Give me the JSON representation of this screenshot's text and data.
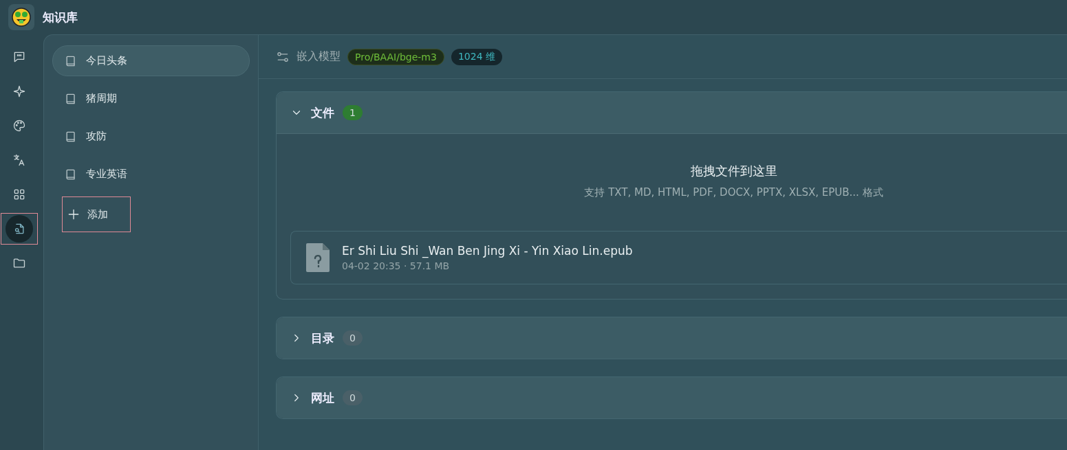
{
  "app": {
    "title": "知识库"
  },
  "rail": [
    {
      "selected": false,
      "highlighted": false
    },
    {
      "selected": false,
      "highlighted": false
    },
    {
      "selected": false,
      "highlighted": false
    },
    {
      "selected": false,
      "highlighted": false
    },
    {
      "selected": false,
      "highlighted": false
    },
    {
      "selected": true,
      "highlighted": true
    },
    {
      "selected": false,
      "highlighted": false
    }
  ],
  "knowledge_bases": [
    {
      "label": "今日头条",
      "selected": true
    },
    {
      "label": "猪周期",
      "selected": false
    },
    {
      "label": "攻防",
      "selected": false
    },
    {
      "label": "专业英语",
      "selected": false
    }
  ],
  "add_button": {
    "label": "添加",
    "highlighted": true
  },
  "toolbar": {
    "label": "嵌入模型",
    "model": "Pro/BAAI/bge-m3",
    "dimensions": "1024 维"
  },
  "sections": [
    {
      "title": "文件",
      "count": "1",
      "expanded": true,
      "color": "#2e7d32",
      "dropzone": {
        "title": "拖拽文件到这里",
        "hint": "支持 TXT, MD, HTML, PDF, DOCX, PPTX, XLSX, EPUB... 格式"
      },
      "files": [
        {
          "name": "Er Shi Liu Shi _Wan Ben Jing Xi - Yin Xiao Lin.epub",
          "meta": "04-02 20:35 · 57.1 MB"
        }
      ]
    },
    {
      "title": "目录",
      "count": "0",
      "expanded": false,
      "color": "#4a6068"
    },
    {
      "title": "网址",
      "count": "0",
      "expanded": false,
      "color": "#4a6068"
    }
  ]
}
